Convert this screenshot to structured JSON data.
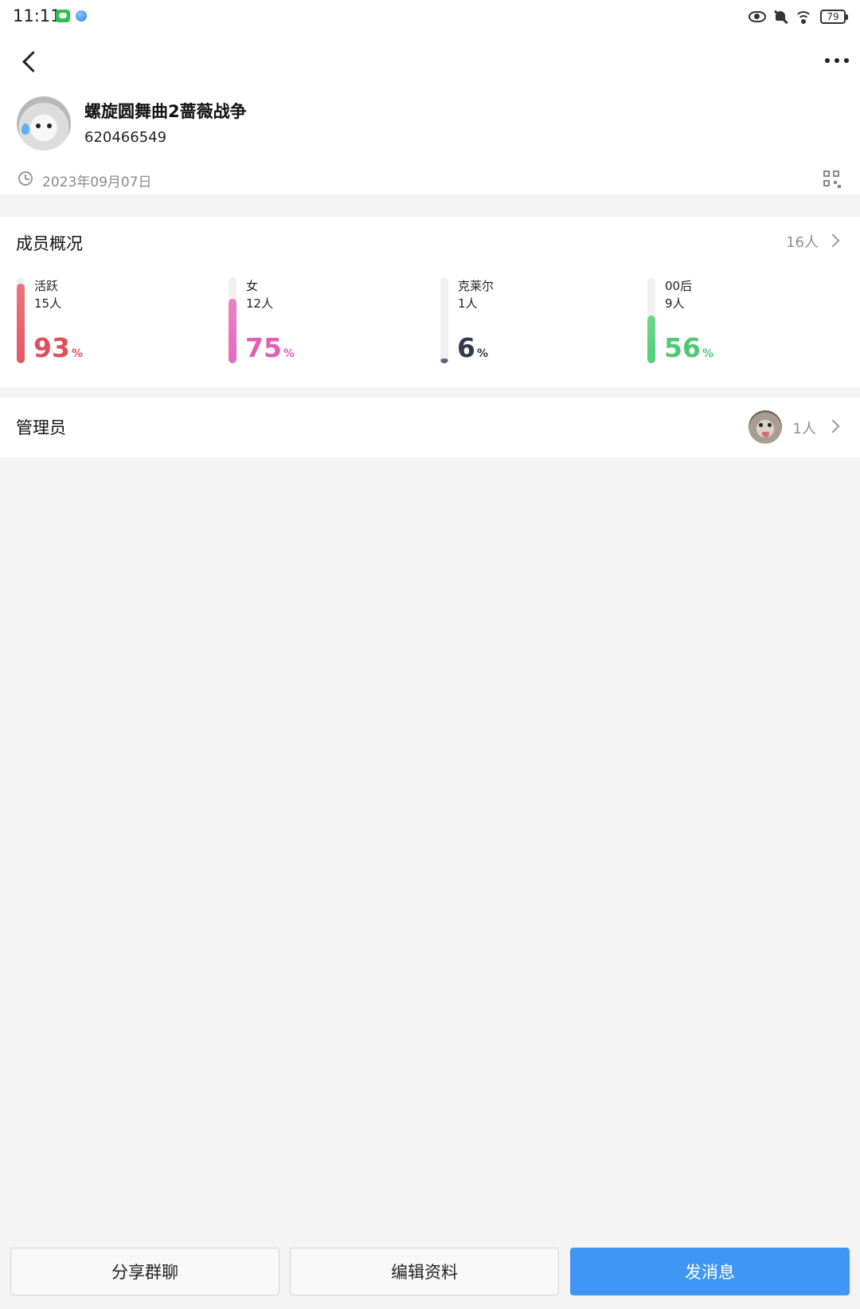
{
  "status_bar": {
    "time": "11:11",
    "battery": "79",
    "icons": [
      "wechat-icon",
      "browser-icon",
      "eye-icon",
      "bell-muted-icon",
      "wifi-icon",
      "battery-icon"
    ]
  },
  "header": {
    "group_name": "螺旋圆舞曲2蔷薇战争",
    "group_id": "620466549",
    "created_date": "2023年09月07日"
  },
  "member_overview": {
    "title": "成员概况",
    "total": "16人",
    "stats": [
      {
        "label": "活跃",
        "count": "15人",
        "percent": "93",
        "percent_value": 93,
        "color": "#e0505c",
        "track_fill_color": "#e65663"
      },
      {
        "label": "女",
        "count": "12人",
        "percent": "75",
        "percent_value": 75,
        "color": "#e25fb4",
        "track_fill_color": "#e768bb"
      },
      {
        "label": "克莱尔",
        "count": "1人",
        "percent": "6",
        "percent_value": 6,
        "color": "#343a4e",
        "track_fill_color": "#4b5166"
      },
      {
        "label": "00后",
        "count": "9人",
        "percent": "56",
        "percent_value": 56,
        "color": "#4fc773",
        "track_fill_color": "#4fcf78"
      }
    ],
    "percent_sign": "%"
  },
  "admins": {
    "title": "管理员",
    "count": "1人"
  },
  "actions": {
    "share": "分享群聊",
    "edit": "编辑资料",
    "send": "发消息"
  },
  "colors": {
    "primary": "#4096f5",
    "page_bg": "#f4f4f5"
  }
}
